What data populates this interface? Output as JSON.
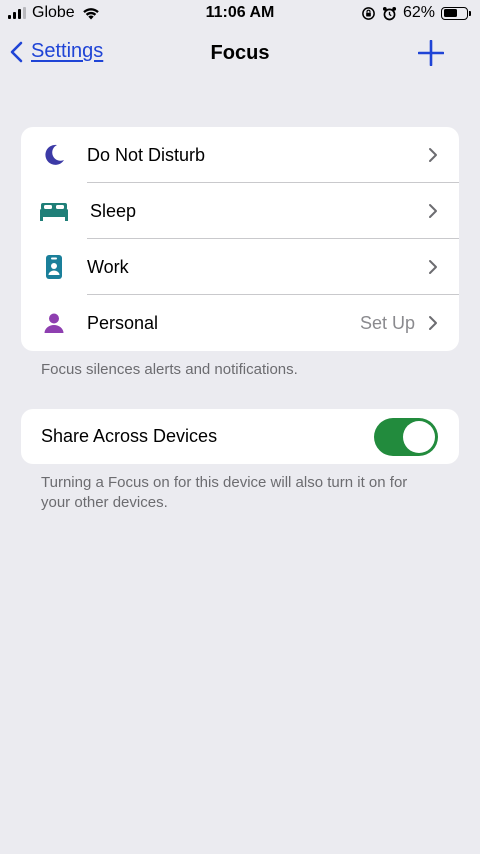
{
  "status_bar": {
    "carrier": "Globe",
    "time": "11:06 AM",
    "battery_percent": "62%",
    "battery_level": 0.62,
    "icons": [
      "signal-icon",
      "wifi-icon",
      "orientation-lock-icon",
      "alarm-icon",
      "battery-icon"
    ]
  },
  "nav": {
    "back_label": "Settings",
    "title": "Focus",
    "add_icon": "plus-icon",
    "accent": "#1f44d6"
  },
  "focus_modes": [
    {
      "label": "Do Not Disturb",
      "icon": "moon-icon",
      "color": "#3c3aa6",
      "detail": ""
    },
    {
      "label": "Sleep",
      "icon": "bed-icon",
      "color": "#1f7f78",
      "detail": ""
    },
    {
      "label": "Work",
      "icon": "id-badge-icon",
      "color": "#1a7f9a",
      "detail": ""
    },
    {
      "label": "Personal",
      "icon": "person-icon",
      "color": "#8e3fb0",
      "detail": "Set Up"
    }
  ],
  "modes_footer": "Focus silences alerts and notifications.",
  "share": {
    "label": "Share Across Devices",
    "enabled": true,
    "toggle_color": "#228b3d",
    "footer": "Turning a Focus on for this device will also turn it on for your other devices."
  }
}
